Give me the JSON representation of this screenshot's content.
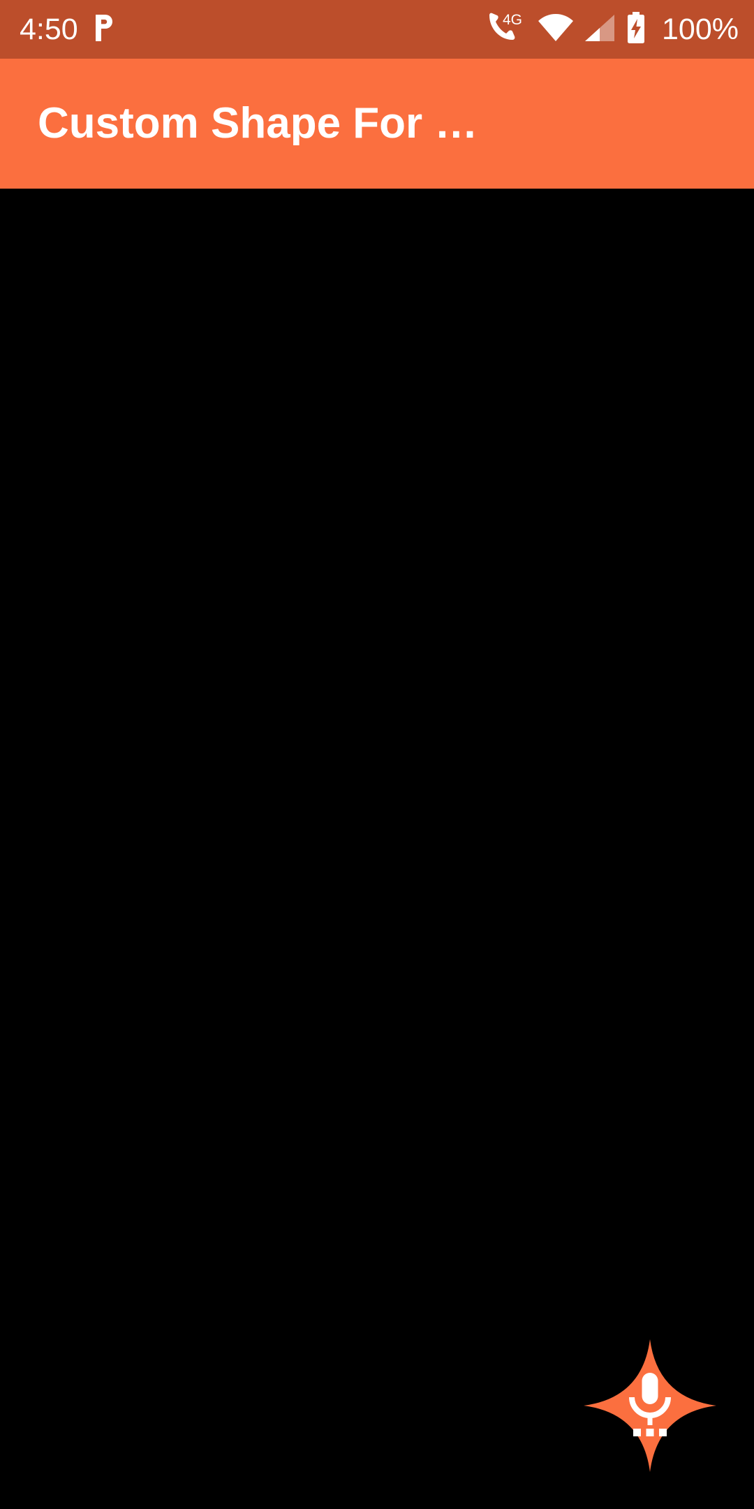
{
  "theme": {
    "status_bar_color": "#BC4E2B",
    "app_bar_color": "#FB6F3F",
    "content_background": "#000000",
    "fab_color": "#FB6F3F",
    "fab_icon_color": "#FFFFFF",
    "text_color": "#FFFFFF"
  },
  "status_bar": {
    "clock": "4:50",
    "notification_icons": [
      "pandora-p-icon"
    ],
    "system_icons": [
      "phone-4g-icon",
      "wifi-icon",
      "cellular-signal-icon",
      "battery-charging-icon"
    ],
    "network_label": "4G",
    "battery_percent": "100%"
  },
  "app_bar": {
    "title": "Custom Shape For …"
  },
  "content": {
    "body_text": ""
  },
  "fab": {
    "shape": "four-pointed-star",
    "icon": "mic-with-dots-icon",
    "label": ""
  }
}
